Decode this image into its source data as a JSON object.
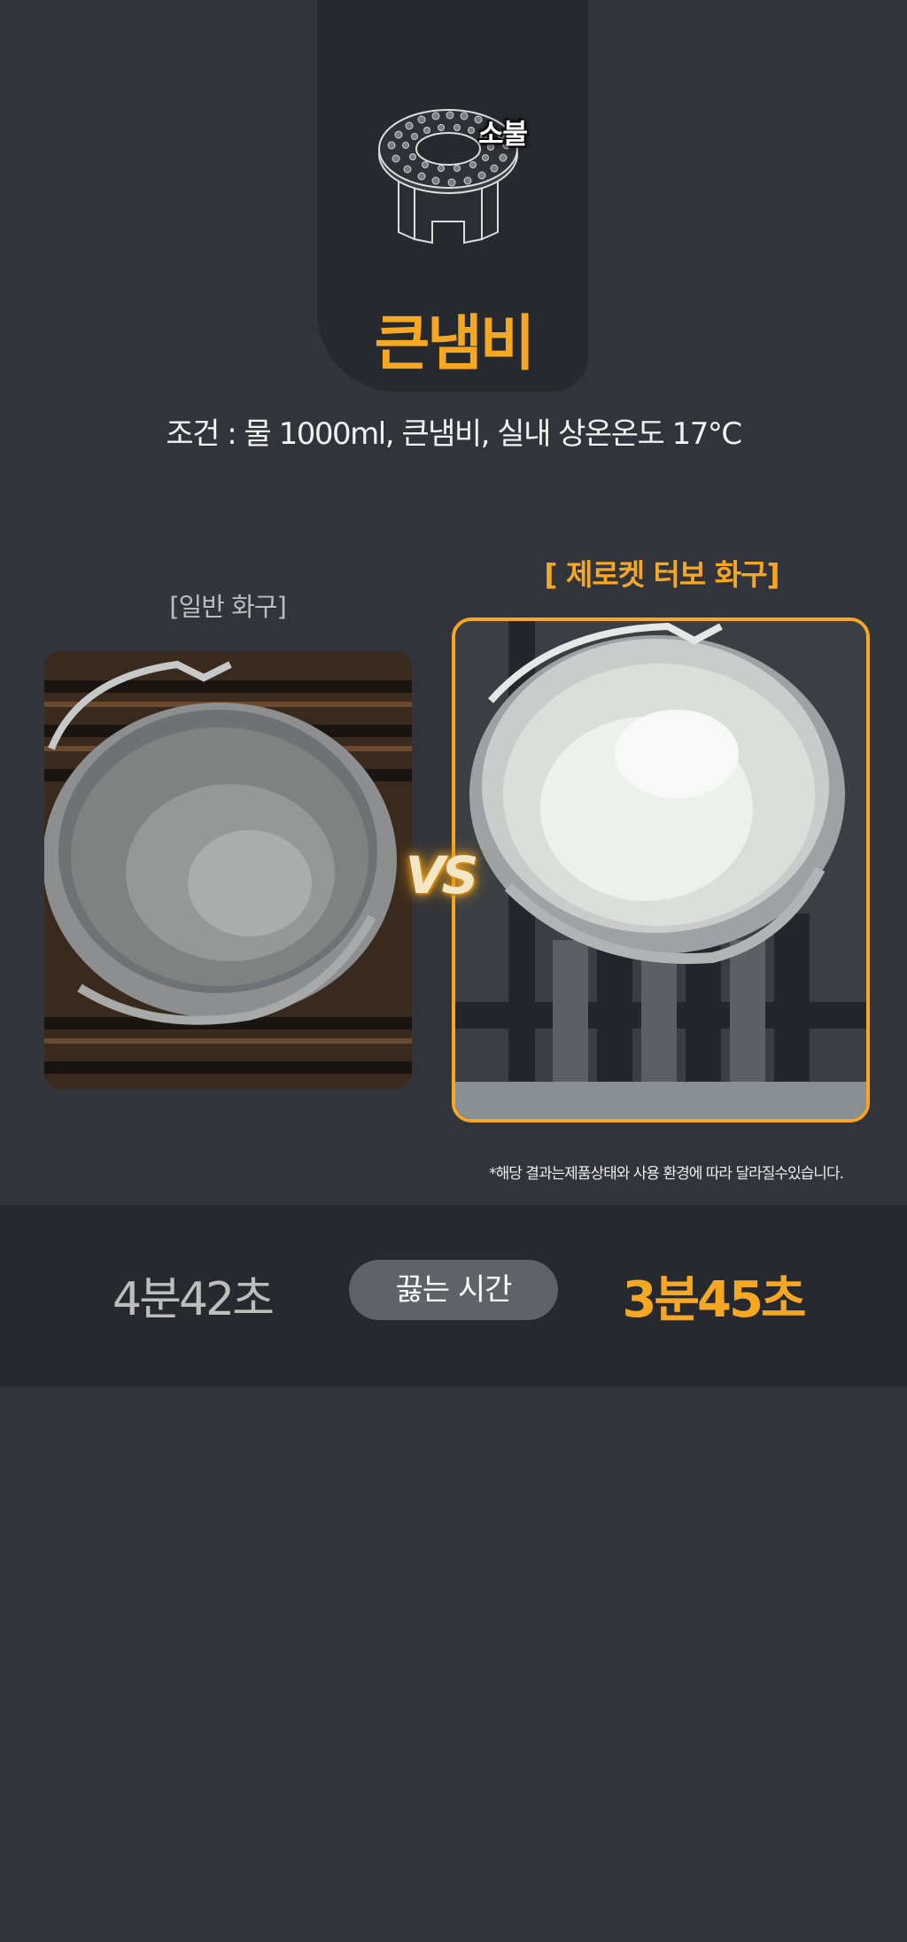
{
  "burner": {
    "label": "소불",
    "icon": "burner-icon"
  },
  "title": "큰냄비",
  "condition": "조건 : 물 1000ml, 큰냄비, 실내 상온온도 17°C",
  "comparison": {
    "normal_label": "[일반 화구]",
    "product_label": "[ 제로켓 터보 화구]",
    "vs": "VS",
    "normal_photo": "pot-photo-normal-burner",
    "product_photo": "pot-photo-turbo-burner"
  },
  "disclaimer": "*해당 결과는제품상태와 사용 환경에 따라 달라질수있습니다.",
  "result": {
    "normal_time": "4분42초",
    "label": "끓는 시간",
    "product_time": "3분45초"
  },
  "colors": {
    "background": "#31343a",
    "panel": "#26292e",
    "accent": "#f7a823",
    "pill": "#5f6267"
  }
}
